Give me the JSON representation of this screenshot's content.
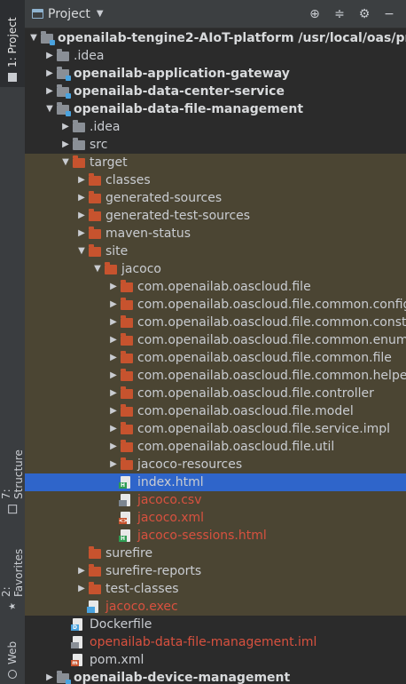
{
  "side": {
    "tabs": [
      {
        "label": "1: Project",
        "active": true,
        "icon": "folder-icon"
      },
      {
        "label": "7: Structure",
        "active": false,
        "icon": "structure-icon"
      },
      {
        "label": "2: Favorites",
        "active": false,
        "icon": "star-icon"
      },
      {
        "label": "Web",
        "active": false,
        "icon": "web-icon"
      }
    ]
  },
  "header": {
    "title": "Project",
    "actions": [
      "target-icon",
      "collapse-all-icon",
      "settings-icon",
      "hide-icon"
    ]
  },
  "tree": {
    "rows": [
      {
        "text": "openailab-tengine2-AIoT-platform",
        "suffix": " /usr/local/oas/proj",
        "depth": 0,
        "arrow": "down",
        "icon": "module",
        "style": "bold"
      },
      {
        "text": ".idea",
        "depth": 1,
        "arrow": "right",
        "icon": "folder-gray"
      },
      {
        "text": "openailab-application-gateway",
        "depth": 1,
        "arrow": "right",
        "icon": "module",
        "style": "bold"
      },
      {
        "text": "openailab-data-center-service",
        "depth": 1,
        "arrow": "right",
        "icon": "module",
        "style": "bold"
      },
      {
        "text": "openailab-data-file-management",
        "depth": 1,
        "arrow": "down",
        "icon": "module",
        "style": "bold"
      },
      {
        "text": ".idea",
        "depth": 2,
        "arrow": "right",
        "icon": "folder-gray"
      },
      {
        "text": "src",
        "depth": 2,
        "arrow": "right",
        "icon": "folder-gray"
      },
      {
        "text": "target",
        "depth": 2,
        "arrow": "down",
        "icon": "folder",
        "hl": true
      },
      {
        "text": "classes",
        "depth": 3,
        "arrow": "right",
        "icon": "folder",
        "hl": true
      },
      {
        "text": "generated-sources",
        "depth": 3,
        "arrow": "right",
        "icon": "folder",
        "hl": true
      },
      {
        "text": "generated-test-sources",
        "depth": 3,
        "arrow": "right",
        "icon": "folder",
        "hl": true
      },
      {
        "text": "maven-status",
        "depth": 3,
        "arrow": "right",
        "icon": "folder",
        "hl": true
      },
      {
        "text": "site",
        "depth": 3,
        "arrow": "down",
        "icon": "folder",
        "hl": true
      },
      {
        "text": "jacoco",
        "depth": 4,
        "arrow": "down",
        "icon": "folder",
        "hl": true
      },
      {
        "text": "com.openailab.oascloud.file",
        "depth": 5,
        "arrow": "right",
        "icon": "folder",
        "hl": true
      },
      {
        "text": "com.openailab.oascloud.file.common.config",
        "depth": 5,
        "arrow": "right",
        "icon": "folder",
        "hl": true
      },
      {
        "text": "com.openailab.oascloud.file.common.consts",
        "depth": 5,
        "arrow": "right",
        "icon": "folder",
        "hl": true
      },
      {
        "text": "com.openailab.oascloud.file.common.enums",
        "depth": 5,
        "arrow": "right",
        "icon": "folder",
        "hl": true
      },
      {
        "text": "com.openailab.oascloud.file.common.file",
        "depth": 5,
        "arrow": "right",
        "icon": "folder",
        "hl": true
      },
      {
        "text": "com.openailab.oascloud.file.common.helper",
        "depth": 5,
        "arrow": "right",
        "icon": "folder",
        "hl": true
      },
      {
        "text": "com.openailab.oascloud.file.controller",
        "depth": 5,
        "arrow": "right",
        "icon": "folder",
        "hl": true
      },
      {
        "text": "com.openailab.oascloud.file.model",
        "depth": 5,
        "arrow": "right",
        "icon": "folder",
        "hl": true
      },
      {
        "text": "com.openailab.oascloud.file.service.impl",
        "depth": 5,
        "arrow": "right",
        "icon": "folder",
        "hl": true
      },
      {
        "text": "com.openailab.oascloud.file.util",
        "depth": 5,
        "arrow": "right",
        "icon": "folder",
        "hl": true
      },
      {
        "text": "jacoco-resources",
        "depth": 5,
        "arrow": "right",
        "icon": "folder",
        "hl": true
      },
      {
        "text": "index.html",
        "depth": 5,
        "arrow": "none",
        "icon": "file-html",
        "sel": true
      },
      {
        "text": "jacoco.csv",
        "depth": 5,
        "arrow": "none",
        "icon": "file-csv",
        "hl": true,
        "style": "red"
      },
      {
        "text": "jacoco.xml",
        "depth": 5,
        "arrow": "none",
        "icon": "file-xml",
        "hl": true,
        "style": "red"
      },
      {
        "text": "jacoco-sessions.html",
        "depth": 5,
        "arrow": "none",
        "icon": "file-html",
        "hl": true,
        "style": "red"
      },
      {
        "text": "surefire",
        "depth": 3,
        "arrow": "none",
        "icon": "folder",
        "hl": true
      },
      {
        "text": "surefire-reports",
        "depth": 3,
        "arrow": "right",
        "icon": "folder",
        "hl": true
      },
      {
        "text": "test-classes",
        "depth": 3,
        "arrow": "right",
        "icon": "folder",
        "hl": true
      },
      {
        "text": "jacoco.exec",
        "depth": 3,
        "arrow": "none",
        "icon": "file-exec",
        "hl": true,
        "style": "red"
      },
      {
        "text": "Dockerfile",
        "depth": 2,
        "arrow": "none",
        "icon": "file-docker"
      },
      {
        "text": "openailab-data-file-management.iml",
        "depth": 2,
        "arrow": "none",
        "icon": "file-iml",
        "style": "red"
      },
      {
        "text": "pom.xml",
        "depth": 2,
        "arrow": "none",
        "icon": "file-maven"
      },
      {
        "text": "openailab-device-management",
        "depth": 1,
        "arrow": "right",
        "icon": "module",
        "style": "bold"
      }
    ]
  },
  "colors": {
    "folder": "#c7532e",
    "highlight_row": "#4b4533",
    "selected_row": "#2f65ca",
    "unversioned_text": "#d8513f"
  }
}
